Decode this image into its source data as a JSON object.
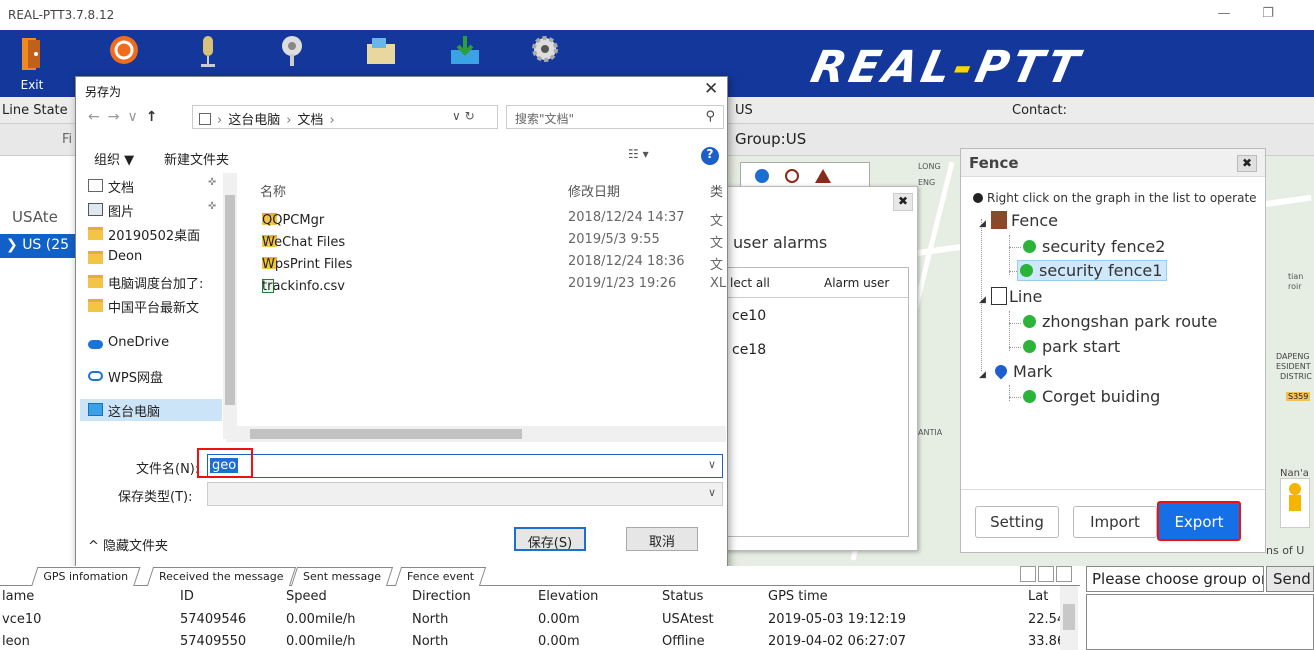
{
  "window": {
    "title": "REAL-PTT3.7.8.12"
  },
  "toolbar": {
    "exit_label": "Exit",
    "brand_left": "REAL",
    "brand_dash": "-",
    "brand_right": "PTT"
  },
  "status": {
    "line_state": "Line State",
    "us": "US",
    "contact": "Contact:",
    "group": "Group:US",
    "left_tab": "Fi"
  },
  "left": {
    "usate": "USAte",
    "us_node": "US (25"
  },
  "save_dialog": {
    "title": "另存为",
    "path": [
      "这台电脑",
      "文档"
    ],
    "search_placeholder": "搜索\"文档\"",
    "organize": "组织 ▼",
    "new_folder": "新建文件夹",
    "nav_items": [
      {
        "label": "文档",
        "icon": "documents-icon"
      },
      {
        "label": "图片",
        "icon": "pictures-icon"
      },
      {
        "label": "20190502桌面",
        "icon": "folder-icon"
      },
      {
        "label": "Deon",
        "icon": "folder-icon"
      },
      {
        "label": "电脑调度台加了:",
        "icon": "folder-icon"
      },
      {
        "label": "中国平台最新文",
        "icon": "folder-icon"
      },
      {
        "label": "OneDrive",
        "icon": "onedrive-icon"
      },
      {
        "label": "WPS网盘",
        "icon": "wps-cloud-icon"
      },
      {
        "label": "这台电脑",
        "icon": "this-pc-icon"
      }
    ],
    "columns": {
      "name": "名称",
      "date": "修改日期",
      "type": "类"
    },
    "files": [
      {
        "name": "QQPCMgr",
        "date": "2018/12/24 14:37",
        "type": "文",
        "kind": "folder"
      },
      {
        "name": "WeChat Files",
        "date": "2019/5/3 9:55",
        "type": "文",
        "kind": "folder"
      },
      {
        "name": "WpsPrint Files",
        "date": "2018/12/24 18:36",
        "type": "文",
        "kind": "folder"
      },
      {
        "name": "trackinfo.csv",
        "date": "2019/1/23 19:26",
        "type": "XL",
        "kind": "file"
      }
    ],
    "filename_label": "文件名(N):",
    "filename_value": "geo",
    "filetype_label": "保存类型(T):",
    "hide_folders": "^ 隐藏文件夹",
    "save_btn": "保存(S)",
    "cancel_btn": "取消"
  },
  "alarm_dialog": {
    "title": "user alarms",
    "select_all": "lect all",
    "alarm_user": "Alarm user",
    "items": [
      "ce10",
      "ce18"
    ]
  },
  "fence_panel": {
    "title": "Fence",
    "hint": "Right click on the graph in the list to operate",
    "fence_group": "Fence",
    "fences": [
      "security fence2",
      "security fence1"
    ],
    "line_group": "Line",
    "lines": [
      "zhongshan park route",
      "park start"
    ],
    "mark_group": "Mark",
    "marks": [
      "Corget buiding"
    ],
    "setting_btn": "Setting",
    "import_btn": "Import",
    "export_btn": "Export"
  },
  "map_labels": [
    "LONG",
    "ENG",
    "ANTIA",
    "tian",
    "roir",
    "DAPENG",
    "ESIDENT",
    "DISTRIC",
    "S359",
    "Nan'a",
    "ns of U"
  ],
  "bottom": {
    "tabs": [
      "GPS infomation",
      "Received the message",
      "Sent message",
      "Fence event"
    ],
    "headers": [
      "lame",
      "ID",
      "Speed",
      "Direction",
      "Elevation",
      "Status",
      "GPS time",
      "Lat"
    ],
    "rows": [
      [
        "vce10",
        "57409546",
        "0.00mile/h",
        "North",
        "0.00m",
        "USAtest",
        "2019-05-03 19:12:19",
        "22.54"
      ],
      [
        "leon",
        "57409550",
        "0.00mile/h",
        "North",
        "0.00m",
        "Offline",
        "2019-04-02 06:27:07",
        "33.86"
      ]
    ],
    "chooser": "Please choose group or",
    "send": "Send"
  }
}
